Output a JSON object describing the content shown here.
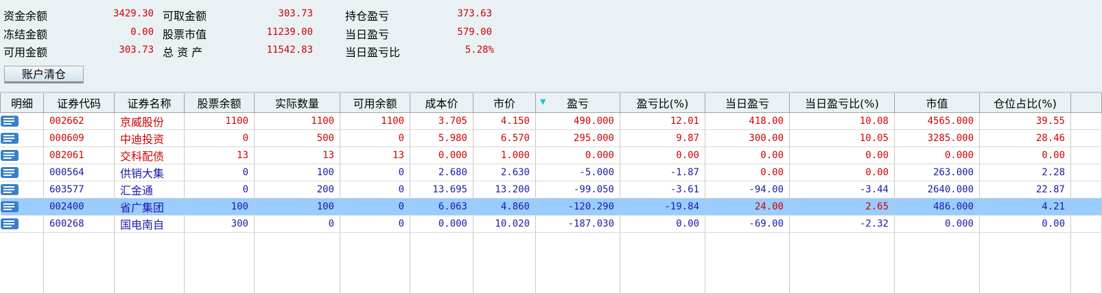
{
  "summary": [
    {
      "label": "资金余额",
      "value": "3429.30"
    },
    {
      "label": "冻结金额",
      "value": "0.00"
    },
    {
      "label": "可用金额",
      "value": "303.73"
    },
    {
      "label": "可取金额",
      "value": "303.73"
    },
    {
      "label": "股票市值",
      "value": "11239.00"
    },
    {
      "label": "总 资 产",
      "value": "11542.83"
    },
    {
      "label": "持仓盈亏",
      "value": "373.63"
    },
    {
      "label": "当日盈亏",
      "value": "579.00"
    },
    {
      "label": "当日盈亏比",
      "value": "5.28%"
    }
  ],
  "clear_button": "账户清仓",
  "headers": [
    "明细",
    "证券代码",
    "证券名称",
    "股票余额",
    "实际数量",
    "可用余额",
    "成本价",
    "市价",
    "盈亏",
    "盈亏比(%)",
    "当日盈亏",
    "当日盈亏比(%)",
    "市值",
    "仓位占比(%)"
  ],
  "sort_icon": "sort-desc-triangle",
  "colors": {
    "red": "#d00000",
    "blue": "#1a1aa6",
    "selected": "#99ccff"
  },
  "rows": [
    {
      "cells": [
        "002662",
        "京威股份",
        "1100",
        "1100",
        "1100",
        "3.705",
        "4.150",
        "490.000",
        "12.01",
        "418.00",
        "10.08",
        "4565.000",
        "39.55"
      ],
      "colors": "rrrrrrrrrrrrr"
    },
    {
      "cells": [
        "000609",
        "中迪投资",
        "0",
        "500",
        "0",
        "5.980",
        "6.570",
        "295.000",
        "9.87",
        "300.00",
        "10.05",
        "3285.000",
        "28.46"
      ],
      "colors": "rrrrrrrrrrrrr"
    },
    {
      "cells": [
        "082061",
        "交科配债",
        "13",
        "13",
        "13",
        "0.000",
        "1.000",
        "0.000",
        "0.00",
        "0.00",
        "0.00",
        "0.000",
        "0.00"
      ],
      "colors": "rrrrrrrrrrrrr"
    },
    {
      "cells": [
        "000564",
        "供销大集",
        "0",
        "100",
        "0",
        "2.680",
        "2.630",
        "-5.000",
        "-1.87",
        "0.00",
        "0.00",
        "263.000",
        "2.28"
      ],
      "colors": "bbbbbbbbbrrbb"
    },
    {
      "cells": [
        "603577",
        "汇金通",
        "0",
        "200",
        "0",
        "13.695",
        "13.200",
        "-99.050",
        "-3.61",
        "-94.00",
        "-3.44",
        "2640.000",
        "22.87"
      ],
      "colors": "bbbbbbbbbbbbb"
    },
    {
      "cells": [
        "002400",
        "省广集团",
        "100",
        "100",
        "0",
        "6.063",
        "4.860",
        "-120.290",
        "-19.84",
        "24.00",
        "2.65",
        "486.000",
        "4.21"
      ],
      "colors": "bbbbbbbbbrrbb",
      "selected": true
    },
    {
      "cells": [
        "600268",
        "国电南自",
        "300",
        "0",
        "0",
        "0.000",
        "10.020",
        "-187.030",
        "0.00",
        "-69.00",
        "-2.32",
        "0.000",
        "0.00"
      ],
      "colors": "bbbbbbbbbbbbb"
    }
  ]
}
